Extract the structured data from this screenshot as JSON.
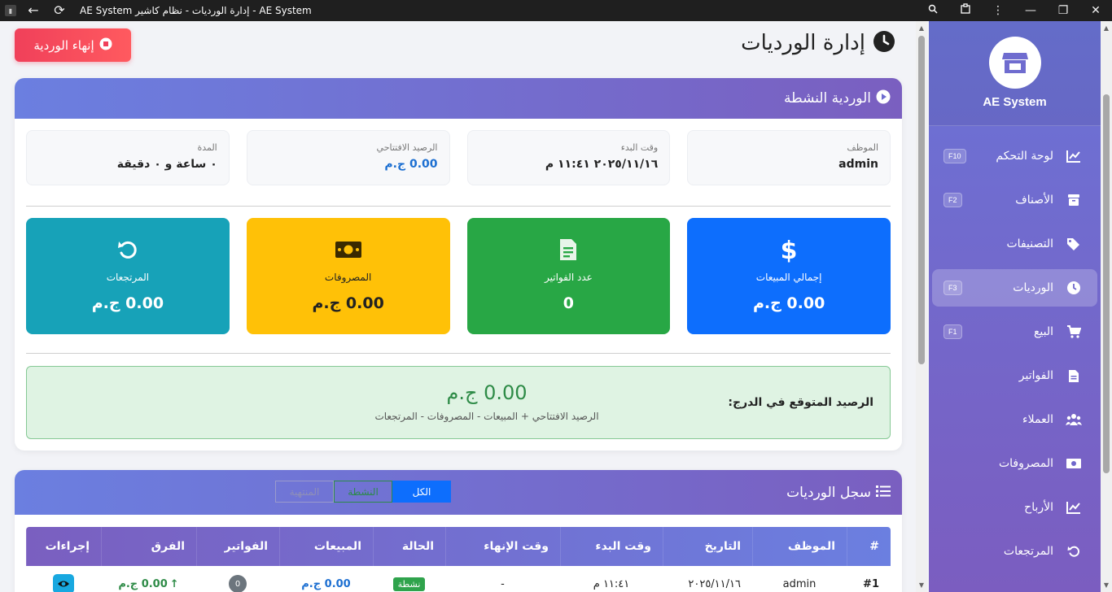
{
  "window": {
    "title": "AE System إدارة الورديات - نظام كاشير - AE System",
    "back_icon": "←",
    "reload_icon": "⟳",
    "search_icon": "🔍",
    "minimize_icon": "—",
    "restore_icon": "❐",
    "close_icon": "✕"
  },
  "sidebar": {
    "app_name": "AE System",
    "items": [
      {
        "label": "لوحة التحكم",
        "key": "F10",
        "icon": "chart-line-icon"
      },
      {
        "label": "الأصناف",
        "key": "F2",
        "icon": "box-icon"
      },
      {
        "label": "التصنيفات",
        "key": "",
        "icon": "tags-icon"
      },
      {
        "label": "الورديات",
        "key": "F3",
        "icon": "clock-icon",
        "active": true
      },
      {
        "label": "البيع",
        "key": "F1",
        "icon": "cart-icon"
      },
      {
        "label": "الفواتير",
        "key": "",
        "icon": "invoice-icon"
      },
      {
        "label": "العملاء",
        "key": "",
        "icon": "users-icon"
      },
      {
        "label": "المصروفات",
        "key": "",
        "icon": "money-icon"
      },
      {
        "label": "الأرباح",
        "key": "",
        "icon": "chart-line-icon"
      },
      {
        "label": "المرتجعات",
        "key": "",
        "icon": "undo-icon"
      }
    ]
  },
  "header": {
    "title": "إدارة الورديات",
    "end_shift_label": "إنهاء الوردية"
  },
  "active_shift": {
    "title": "الوردية النشطة",
    "info": [
      {
        "label": "الموظف",
        "value": "admin"
      },
      {
        "label": "وقت البدء",
        "value": "٢٠٢٥/١١/١٦ ١١:٤١ م"
      },
      {
        "label": "الرصيد الافتتاحي",
        "value": "0.00 ج.م"
      },
      {
        "label": "المدة",
        "value": "٠ ساعة و ٠ دقيقة"
      }
    ],
    "stats": [
      {
        "label": "إجمالي المبيعات",
        "value": "0.00 ج.م",
        "color": "#0d6efd",
        "icon": "dollar-icon"
      },
      {
        "label": "عدد الفواتير",
        "value": "0",
        "color": "#28a745",
        "icon": "invoice-icon"
      },
      {
        "label": "المصروفات",
        "value": "0.00 ج.م",
        "color": "#ffc107",
        "icon": "money-icon"
      },
      {
        "label": "المرتجعات",
        "value": "0.00 ج.م",
        "color": "#17a2b8",
        "icon": "undo-icon"
      }
    ],
    "expected_label": "الرصيد المتوقع في الدرج:",
    "expected_value": "0.00 ج.م",
    "expected_formula": "الرصيد الافتتاحي + المبيعات - المصروفات - المرتجعات"
  },
  "shift_log": {
    "title": "سجل الورديات",
    "filters": {
      "all": "الكل",
      "active": "النشطة",
      "done": "المنتهية"
    },
    "columns": [
      "#",
      "الموظف",
      "التاريخ",
      "وقت البدء",
      "وقت الإنهاء",
      "الحالة",
      "المبيعات",
      "الفواتير",
      "الفرق",
      "إجراءات"
    ],
    "rows": [
      {
        "num": "#1",
        "employee": "admin",
        "date": "٢٠٢٥/١١/١٦",
        "start": "١١:٤١ م",
        "end": "-",
        "status": "نشطة",
        "sales": "0.00 ج.م",
        "invoices": "0",
        "diff": "0.00 ج.م"
      }
    ]
  },
  "colors": {
    "accent_start": "#6b7fe0",
    "accent_end": "#7a5fc0",
    "danger": "#f0405a",
    "success": "#28a745"
  }
}
